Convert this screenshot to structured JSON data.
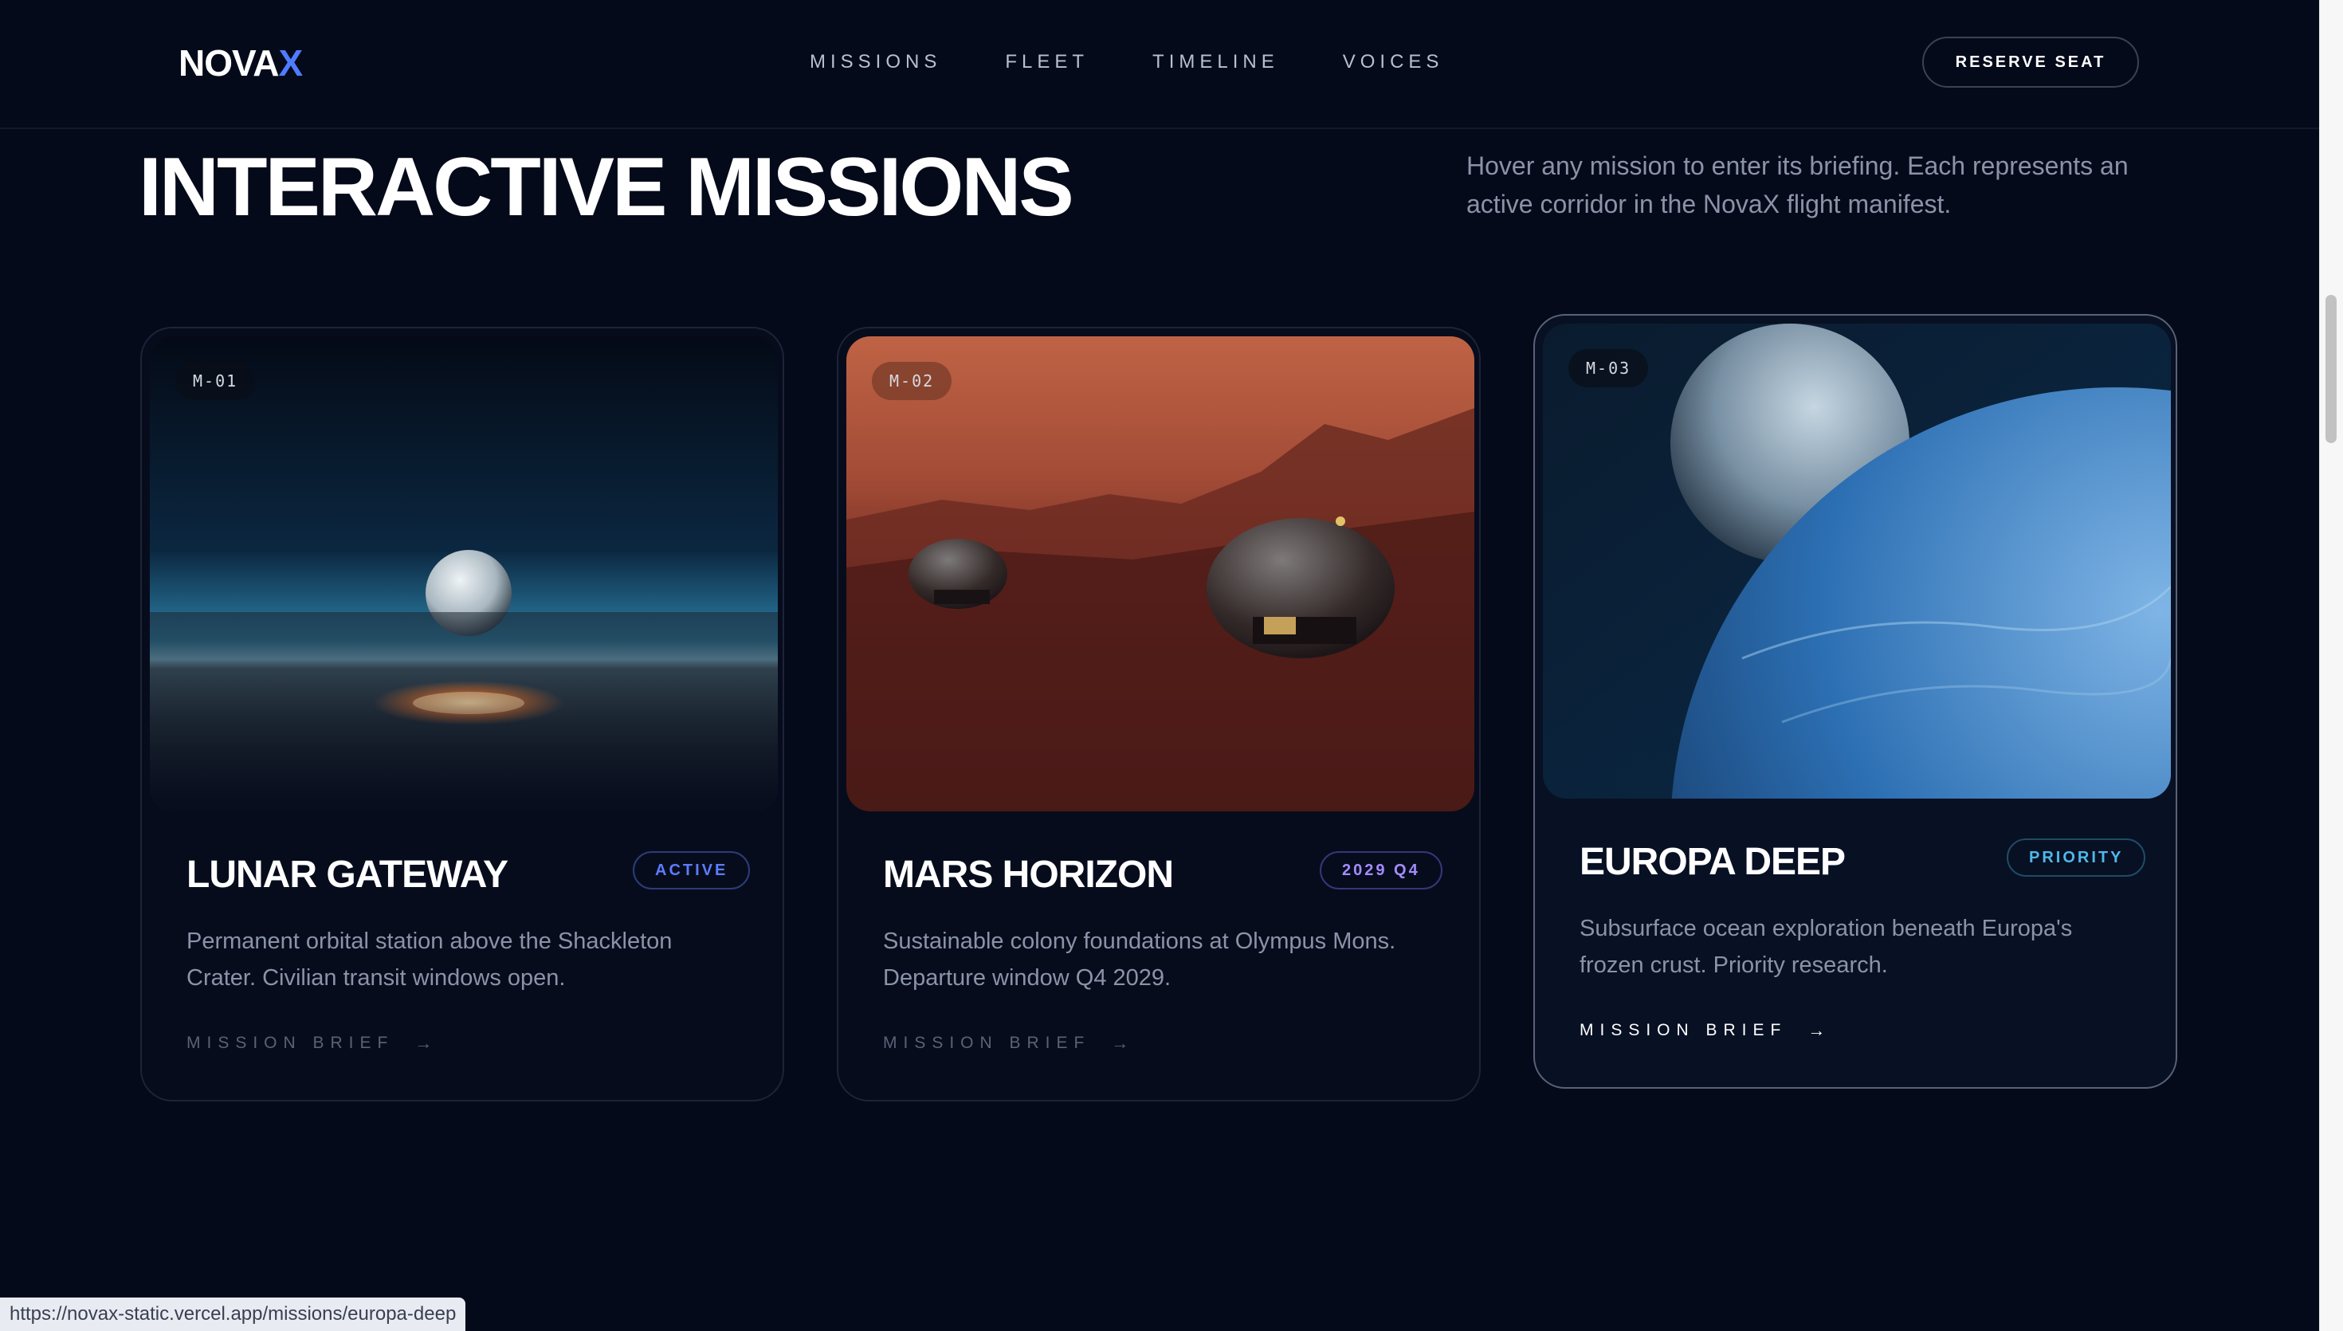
{
  "header": {
    "logo_main": "NOVA",
    "logo_accent": "X",
    "nav": [
      "MISSIONS",
      "FLEET",
      "TIMELINE",
      "VOICES"
    ],
    "cta_label": "RESERVE SEAT"
  },
  "section": {
    "title": "INTERACTIVE MISSIONS",
    "description": "Hover any mission to enter its briefing. Each represents an active corridor in the NovaX flight manifest."
  },
  "missions": [
    {
      "code": "M-01",
      "title": "LUNAR GATEWAY",
      "badge": "ACTIVE",
      "badge_color": "#5b7cff",
      "description": "Permanent orbital station above the Shackleton Crater. Civilian transit windows open.",
      "cta": "MISSION BRIEF",
      "arrow": "→",
      "image": "lunar-surface-horizon"
    },
    {
      "code": "M-02",
      "title": "MARS HORIZON",
      "badge": "2029 Q4",
      "badge_color": "#a48cff",
      "description": "Sustainable colony foundations at Olympus Mons. Departure window Q4 2029.",
      "cta": "MISSION BRIEF",
      "arrow": "→",
      "image": "mars-habitat-domes"
    },
    {
      "code": "M-03",
      "title": "EUROPA DEEP",
      "badge": "PRIORITY",
      "badge_color": "#4fb8e8",
      "description": "Subsurface ocean exploration beneath Europa's frozen crust. Priority research.",
      "cta": "MISSION BRIEF",
      "arrow": "→",
      "image": "europa-planet-view"
    }
  ],
  "status_bar": {
    "url": "https://novax-static.vercel.app/missions/europa-deep"
  }
}
